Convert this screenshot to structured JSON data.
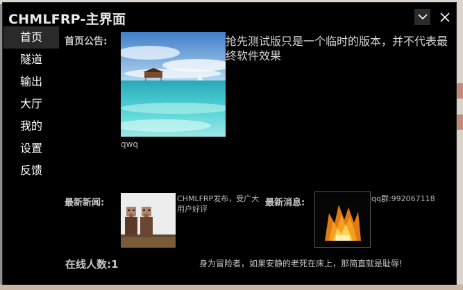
{
  "window": {
    "title": "CHMLFRP-主界面"
  },
  "sidebar": {
    "items": [
      {
        "label": "首页",
        "active": true
      },
      {
        "label": "隧道",
        "active": false
      },
      {
        "label": "输出",
        "active": false
      },
      {
        "label": "大厅",
        "active": false
      },
      {
        "label": "我的",
        "active": false
      },
      {
        "label": "设置",
        "active": false
      },
      {
        "label": "反馈",
        "active": false
      }
    ]
  },
  "home": {
    "notice_label": "首页公告:",
    "notice_image_caption": "qwq",
    "notice_text": "抢先测试版只是一个临时的版本，并不代表最终软件效果",
    "news_label": "最新新闻:",
    "news_text": "CHMLFRP发布，受广大用户好评",
    "message_label": "最新消息:",
    "message_text": "qq群:992067118",
    "online_label": "在线人数:1",
    "motto": "身为冒险者，如果安静的老死在床上，那简直就是耻辱!"
  },
  "icons": {
    "minimize": "chevron-down-icon",
    "close": "close-icon"
  }
}
